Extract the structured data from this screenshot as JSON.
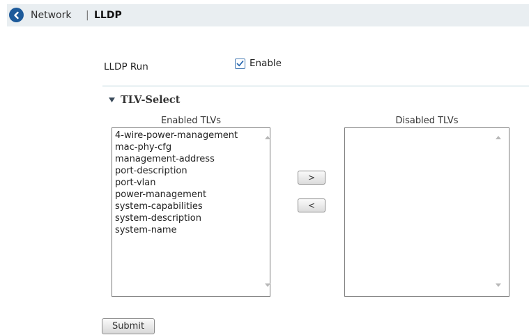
{
  "breadcrumb": {
    "parent": "Network",
    "separator": "|",
    "current": "LLDP"
  },
  "lldp_run": {
    "label": "LLDP Run",
    "checkbox_label": "Enable",
    "checked": true
  },
  "tlv_select": {
    "title": "TLV-Select",
    "enabled_title": "Enabled TLVs",
    "disabled_title": "Disabled TLVs",
    "enabled_items": [
      "4-wire-power-management",
      "mac-phy-cfg",
      "management-address",
      "port-description",
      "port-vlan",
      "power-management",
      "system-capabilities",
      "system-description",
      "system-name"
    ],
    "disabled_items": [],
    "move_right_label": ">",
    "move_left_label": "<"
  },
  "submit_label": "Submit",
  "colors": {
    "header_bg": "#e9eef1",
    "back_icon": "#1d5a9a",
    "divider": "#b8d3da",
    "checkbox_border": "#4a7db5"
  },
  "icons": {
    "back": "back-arrow-circle-icon",
    "collapse": "triangle-down-icon",
    "checkbox": "checkmark-icon"
  }
}
